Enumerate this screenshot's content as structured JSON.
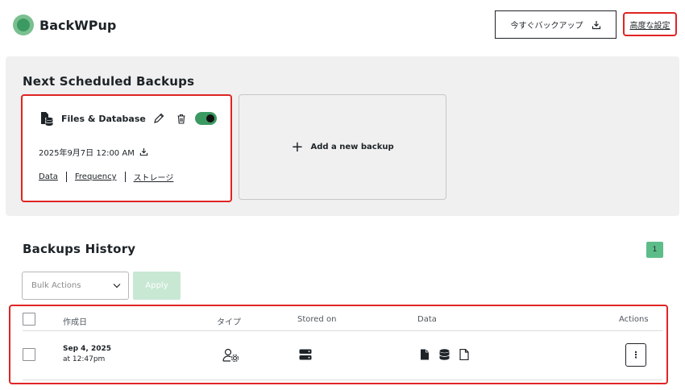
{
  "header": {
    "app_name": "BackWPup",
    "backup_now_label": "今すぐバックアップ",
    "advanced_settings_label": "高度な設定"
  },
  "scheduled": {
    "title": "Next Scheduled Backups",
    "job": {
      "name": "Files & Database",
      "enabled": true,
      "next_run": "2025年9月7日 12:00 AM",
      "links": [
        "Data",
        "Frequency",
        "ストレージ"
      ]
    },
    "add_label": "Add a new backup"
  },
  "history": {
    "title": "Backups History",
    "page_count": "1",
    "bulk_actions_label": "Bulk Actions",
    "apply_label": "Apply",
    "columns": {
      "created": "作成日",
      "type": "タイプ",
      "stored_on": "Stored on",
      "data": "Data",
      "actions": "Actions"
    },
    "rows": [
      {
        "date": "Sep 4, 2025",
        "time": "at 12:47pm",
        "type_icon": "user-gear-icon",
        "storage_icon": "server-icon",
        "data_icons": [
          "file-icon",
          "database-icon",
          "file-outline-icon"
        ],
        "action_label": "⋮"
      }
    ]
  },
  "colors": {
    "accent": "#3b9a62",
    "highlight_border": "#e02424",
    "badge": "#5dbd89",
    "apply_disabled": "#c8e8d4",
    "panel_bg": "#f0f0f0"
  }
}
